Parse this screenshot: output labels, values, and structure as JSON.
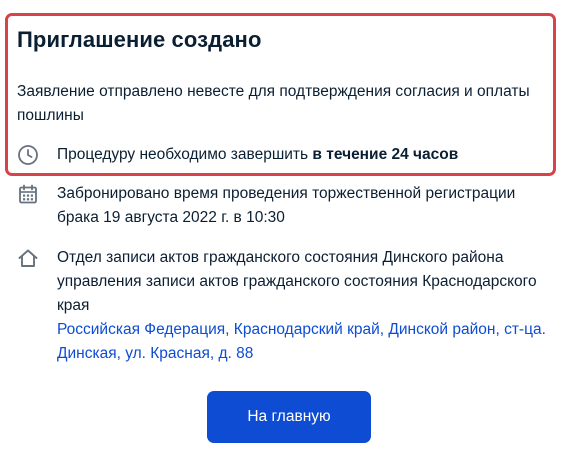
{
  "notice": {
    "title": "Приглашение создано",
    "description": "Заявление отправлено невесте для подтверждения согласия и оплаты пошлины",
    "deadline_prefix": "Процедуру необходимо завершить ",
    "deadline_bold": "в течение 24 часов",
    "deadline_icon": "clock-icon"
  },
  "booking": {
    "icon": "calendar-icon",
    "text": "Забронировано время проведения торжественной регистрации брака 19 августа 2022 г. в 10:30"
  },
  "office": {
    "icon": "home-icon",
    "name": "Отдел записи актов гражданского состояния Динского района управления записи актов гражданского состояния Краснодарского края",
    "address": "Российская Федерация, Краснодарский край, Динской район, ст-ца. Динская, ул. Красная, д. 88"
  },
  "actions": {
    "home_label": "На главную"
  },
  "colors": {
    "highlight_border": "#d6434a",
    "primary": "#0d4cd3",
    "text": "#0b1f33",
    "icon": "#66727f"
  }
}
